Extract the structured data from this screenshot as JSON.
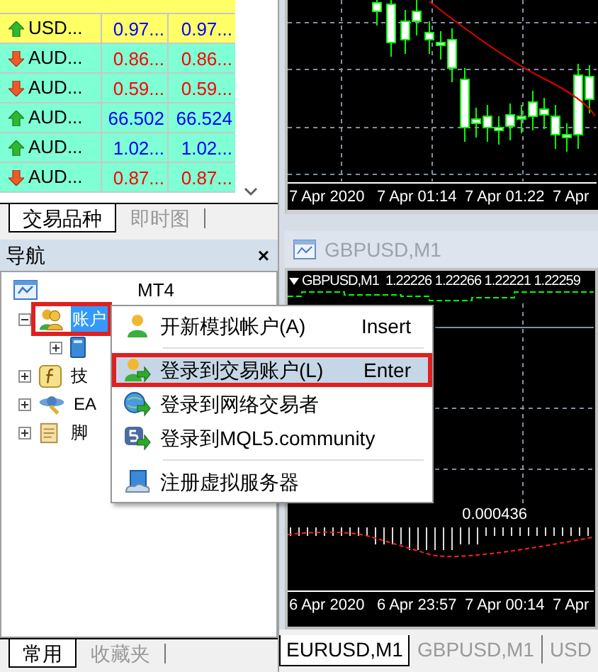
{
  "market_watch": {
    "rows": [
      {
        "symbol": "USD...",
        "bid": "0.97...",
        "ask": "0.97...",
        "rising": true,
        "highlighted": true
      },
      {
        "symbol": "AUD...",
        "bid": "0.86...",
        "ask": "0.86...",
        "rising": false,
        "highlighted": false
      },
      {
        "symbol": "AUD...",
        "bid": "0.59...",
        "ask": "0.59...",
        "rising": false,
        "highlighted": false
      },
      {
        "symbol": "AUD...",
        "bid": "66.502",
        "ask": "66.524",
        "rising": true,
        "highlighted": false
      },
      {
        "symbol": "AUD...",
        "bid": "1.02...",
        "ask": "1.02...",
        "rising": true,
        "highlighted": false
      },
      {
        "symbol": "AUD...",
        "bid": "0.87...",
        "ask": "0.87...",
        "rising": false,
        "highlighted": false
      }
    ],
    "tabs": [
      {
        "label": "交易品种",
        "selected": true
      },
      {
        "label": "即时图",
        "selected": false
      }
    ]
  },
  "navigator": {
    "title": "导航",
    "close": "×",
    "tree": [
      {
        "label": "MT4",
        "kind": "terminal",
        "selected": false,
        "children": [
          {
            "label": "账户",
            "kind": "accounts",
            "expanded": true,
            "selected": true,
            "annotated": true,
            "children": [
              {
                "kind": "server",
                "expanded": false
              }
            ]
          },
          {
            "label": "技",
            "kind": "indicators",
            "expanded": false,
            "selected": false,
            "annotated": false
          },
          {
            "label": "EA",
            "kind": "experts",
            "expanded": false,
            "selected": false,
            "annotated": false
          },
          {
            "label": "脚",
            "kind": "scripts",
            "expanded": false,
            "selected": false,
            "annotated": false
          }
        ]
      }
    ],
    "tabs": [
      {
        "label": "常用",
        "selected": true
      },
      {
        "label": "收藏夹",
        "selected": false
      }
    ]
  },
  "context_menu": {
    "items": [
      {
        "kind": "item",
        "label": "开新模拟帐户(A)",
        "shortcut": "Insert",
        "selected": false,
        "annotated": false
      },
      {
        "kind": "separator"
      },
      {
        "kind": "item",
        "label": "登录到交易账户(L)",
        "shortcut": "Enter",
        "selected": true,
        "annotated": true
      },
      {
        "kind": "item",
        "label": "登录到网络交易者",
        "selected": false,
        "annotated": false
      },
      {
        "kind": "item",
        "label": "登录到MQL5.community",
        "selected": false,
        "annotated": false
      },
      {
        "kind": "separator"
      },
      {
        "kind": "item",
        "label": "注册虚拟服务器",
        "selected": false,
        "annotated": false
      }
    ]
  },
  "top_chart": {
    "time_labels": [
      "7 Apr 2020",
      "7 Apr 01:14",
      "7 Apr 01:22",
      "7 Apr"
    ]
  },
  "chart_window": {
    "title": "GBPUSD,M1",
    "header": "GBPUSD,M1  1.22226 1.22266 1.22221 1.22259",
    "indicator_label": "0.000436",
    "time_labels": [
      "6 Apr 2020",
      "6 Apr 23:57",
      "7 Apr 00:14",
      "7 Apr"
    ]
  },
  "chart_tabs": [
    {
      "label": "EURUSD,M1",
      "selected": true
    },
    {
      "label": "GBPUSD,M1",
      "selected": false
    },
    {
      "label": "USD",
      "selected": false
    }
  ]
}
